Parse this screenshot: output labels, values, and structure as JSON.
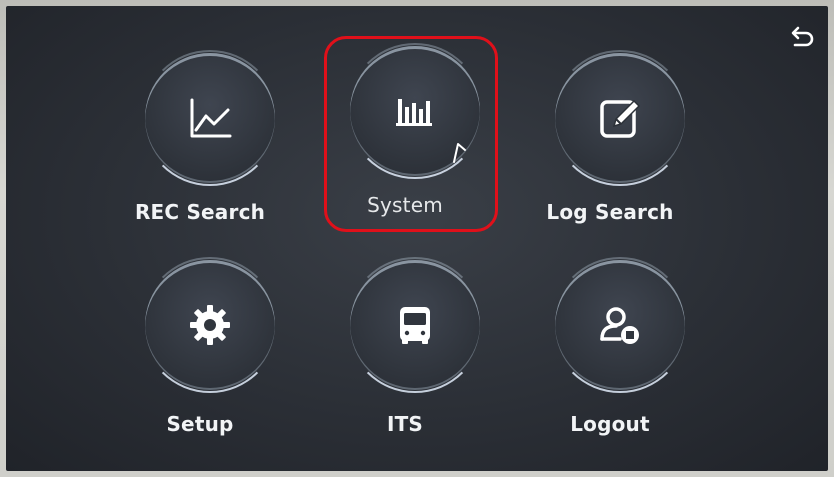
{
  "window": {
    "back_icon": "return-arrow-icon"
  },
  "menu": [
    {
      "id": "rec-search",
      "label": "REC Search",
      "icon": "line-chart-icon"
    },
    {
      "id": "system",
      "label": "System",
      "icon": "bar-chart-icon",
      "selected": true
    },
    {
      "id": "log-search",
      "label": "Log Search",
      "icon": "edit-note-icon"
    },
    {
      "id": "setup",
      "label": "Setup",
      "icon": "gear-icon"
    },
    {
      "id": "its",
      "label": "ITS",
      "icon": "bus-icon"
    },
    {
      "id": "logout",
      "label": "Logout",
      "icon": "user-logout-icon"
    }
  ],
  "colors": {
    "background": "#2b2f36",
    "highlight": "#e0101a",
    "text": "#f2f4f6"
  }
}
